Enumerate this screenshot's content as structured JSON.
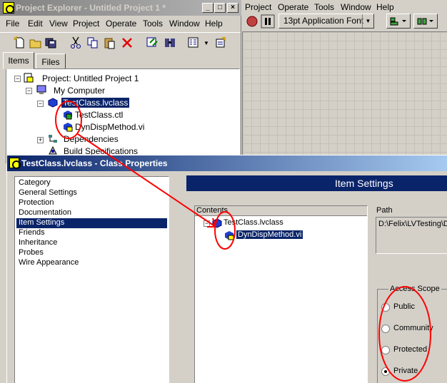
{
  "project_explorer": {
    "title": "Project Explorer - Untitled Project 1 *",
    "menu": [
      "File",
      "Edit",
      "View",
      "Project",
      "Operate",
      "Tools",
      "Window",
      "Help"
    ],
    "tabs": [
      "Items",
      "Files"
    ],
    "tree": [
      {
        "label": "Project: Untitled Project 1",
        "icon": "project-icon"
      },
      {
        "label": "My Computer",
        "icon": "computer-icon"
      },
      {
        "label": "TestClass.lvclass",
        "icon": "lvclass-icon",
        "selected": true
      },
      {
        "label": "TestClass.ctl",
        "icon": "control-icon"
      },
      {
        "label": "DynDispMethod.vi",
        "icon": "vi-icon"
      },
      {
        "label": "Dependencies",
        "icon": "dependencies-icon"
      },
      {
        "label": "Build Specifications",
        "icon": "build-specs-icon"
      }
    ]
  },
  "front_panel": {
    "menu": [
      "Project",
      "Operate",
      "Tools",
      "Window",
      "Help"
    ],
    "font_selector": "13pt Application Font"
  },
  "dialog": {
    "title": "TestClass.lvclass - Class Properties",
    "category_header": "Category",
    "categories": [
      "General Settings",
      "Protection",
      "Documentation",
      "Item Settings",
      "Friends",
      "Inheritance",
      "Probes",
      "Wire Appearance"
    ],
    "selected_category": "Item Settings",
    "banner": "Item Settings",
    "contents_header": "Contents",
    "contents_tree": [
      "TestClass.lvclass",
      "DynDispMethod.vi"
    ],
    "path_label": "Path",
    "path_value": "D:\\Felix\\LVTesting\\D",
    "access_scope_label": "Access Scope",
    "access_scope_options": [
      "Public",
      "Community",
      "Protected",
      "Private"
    ],
    "access_scope_selected": "Private"
  },
  "colors": {
    "annotation": "#ff0000",
    "selection": "#0a246a",
    "window_face": "#d4d0c8"
  }
}
